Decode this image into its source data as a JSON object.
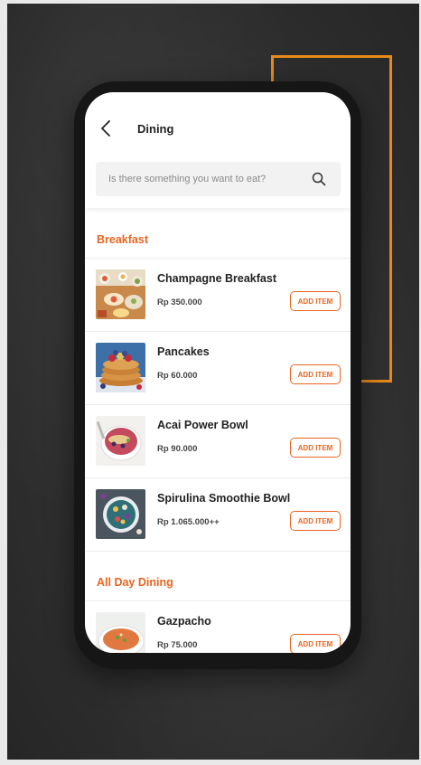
{
  "header": {
    "title": "Dining"
  },
  "search": {
    "placeholder": "Is there something you want to eat?"
  },
  "sections": [
    {
      "title": "Breakfast",
      "items": [
        {
          "name": "Champagne Breakfast",
          "price": "Rp 350.000",
          "button": "ADD ITEM"
        },
        {
          "name": "Pancakes",
          "price": "Rp 60.000",
          "button": "ADD ITEM"
        },
        {
          "name": "Acai Power Bowl",
          "price": "Rp 90.000",
          "button": "ADD ITEM"
        },
        {
          "name": "Spirulina Smoothie Bowl",
          "price": "Rp 1.065.000++",
          "button": "ADD ITEM"
        }
      ]
    },
    {
      "title": "All Day Dining",
      "items": [
        {
          "name": "Gazpacho",
          "price": "Rp 75.000",
          "button": "ADD ITEM"
        }
      ]
    }
  ],
  "colors": {
    "accent": "#e9651f",
    "frame": "#e88a1a",
    "background": "#2c2c2c"
  }
}
